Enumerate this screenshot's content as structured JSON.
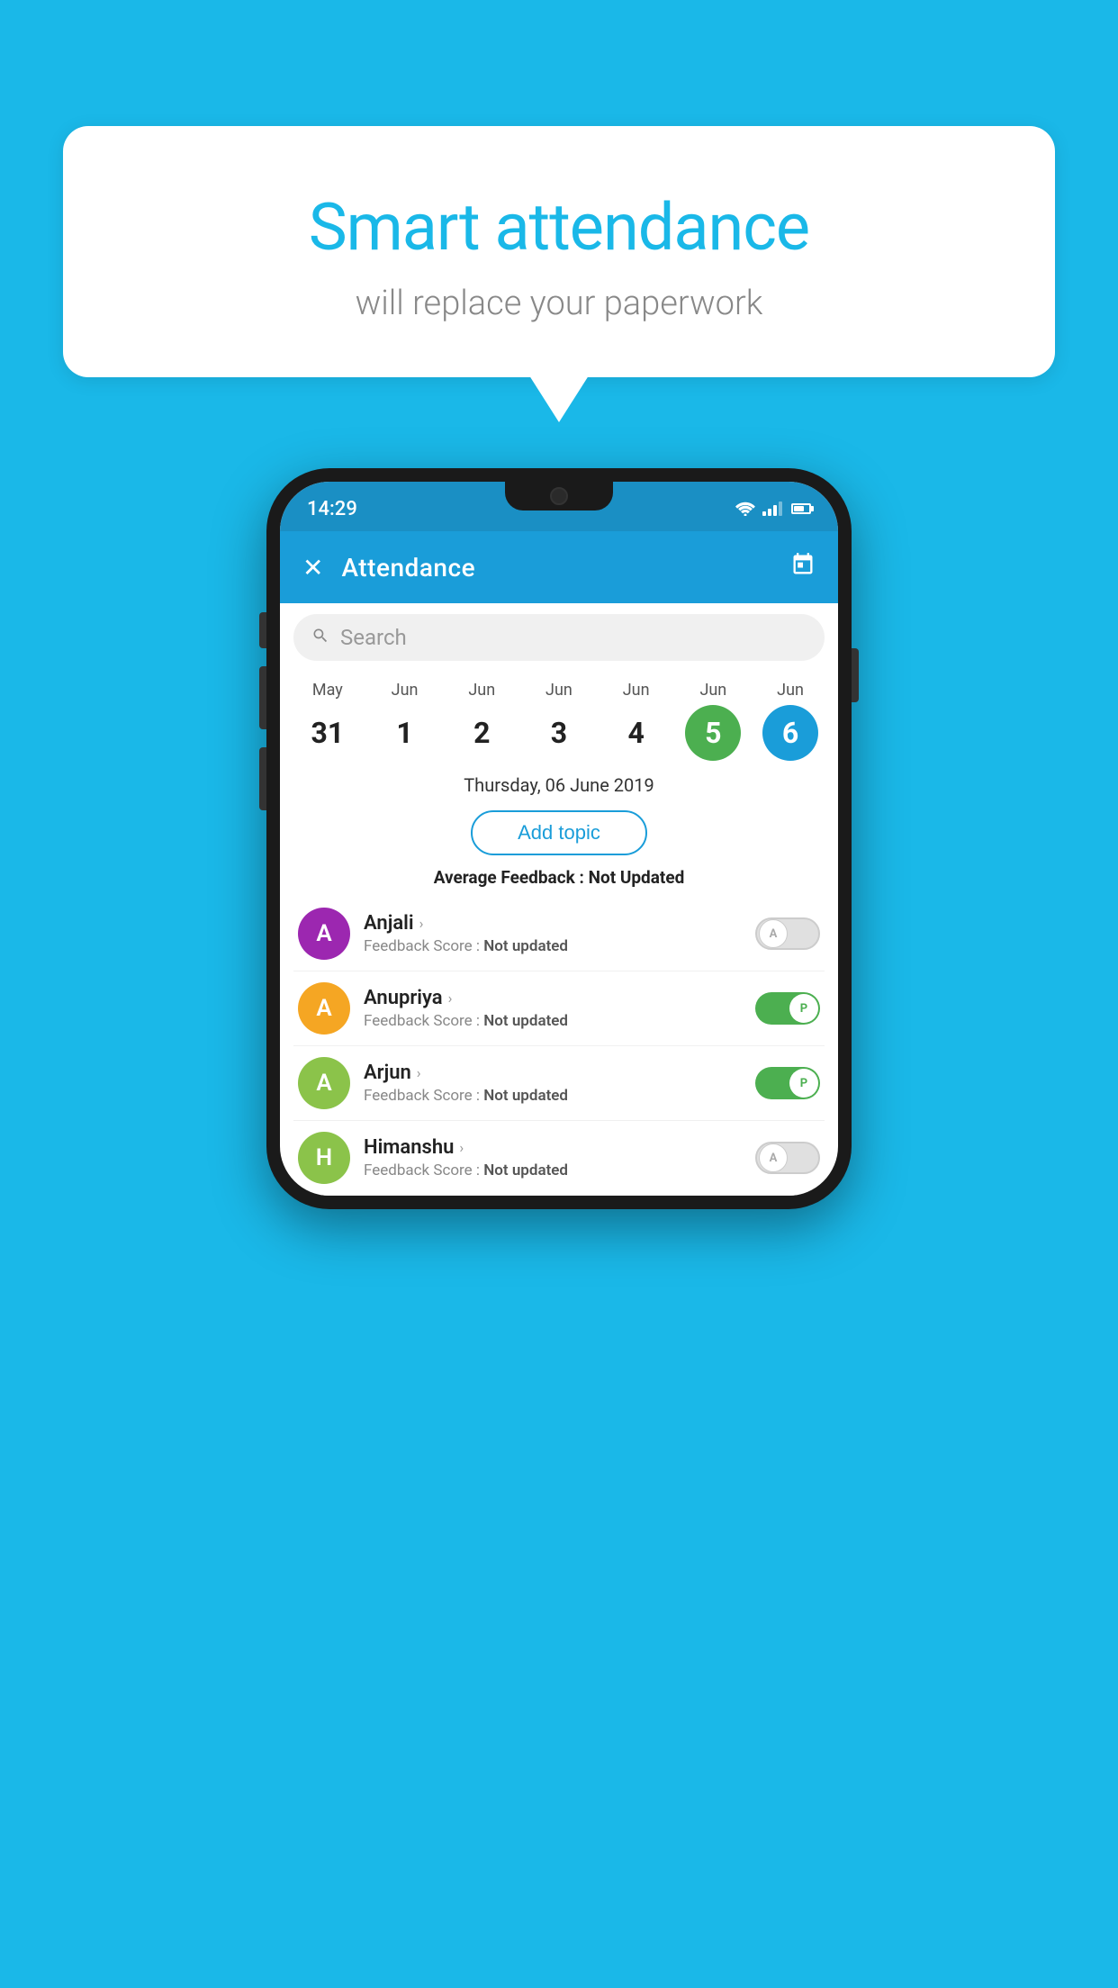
{
  "background_color": "#1ab8e8",
  "bubble": {
    "title": "Smart attendance",
    "subtitle": "will replace your paperwork"
  },
  "status_bar": {
    "time": "14:29"
  },
  "header": {
    "title": "Attendance",
    "close_label": "✕",
    "calendar_icon": "📅"
  },
  "search": {
    "placeholder": "Search"
  },
  "calendar": {
    "days": [
      {
        "month": "May",
        "date": "31",
        "style": "normal"
      },
      {
        "month": "Jun",
        "date": "1",
        "style": "normal"
      },
      {
        "month": "Jun",
        "date": "2",
        "style": "normal"
      },
      {
        "month": "Jun",
        "date": "3",
        "style": "normal"
      },
      {
        "month": "Jun",
        "date": "4",
        "style": "normal"
      },
      {
        "month": "Jun",
        "date": "5",
        "style": "today"
      },
      {
        "month": "Jun",
        "date": "6",
        "style": "selected"
      }
    ]
  },
  "selected_date": "Thursday, 06 June 2019",
  "add_topic_label": "Add topic",
  "avg_feedback_label": "Average Feedback : ",
  "avg_feedback_value": "Not Updated",
  "students": [
    {
      "name": "Anjali",
      "avatar_letter": "A",
      "avatar_color": "#9c27b0",
      "feedback_label": "Feedback Score : ",
      "feedback_value": "Not updated",
      "toggle": "off",
      "toggle_letter": "A"
    },
    {
      "name": "Anupriya",
      "avatar_letter": "A",
      "avatar_color": "#f5a623",
      "feedback_label": "Feedback Score : ",
      "feedback_value": "Not updated",
      "toggle": "on",
      "toggle_letter": "P"
    },
    {
      "name": "Arjun",
      "avatar_letter": "A",
      "avatar_color": "#8bc34a",
      "feedback_label": "Feedback Score : ",
      "feedback_value": "Not updated",
      "toggle": "on",
      "toggle_letter": "P"
    },
    {
      "name": "Himanshu",
      "avatar_letter": "H",
      "avatar_color": "#8bc34a",
      "feedback_label": "Feedback Score : ",
      "feedback_value": "Not updated",
      "toggle": "off",
      "toggle_letter": "A"
    }
  ]
}
